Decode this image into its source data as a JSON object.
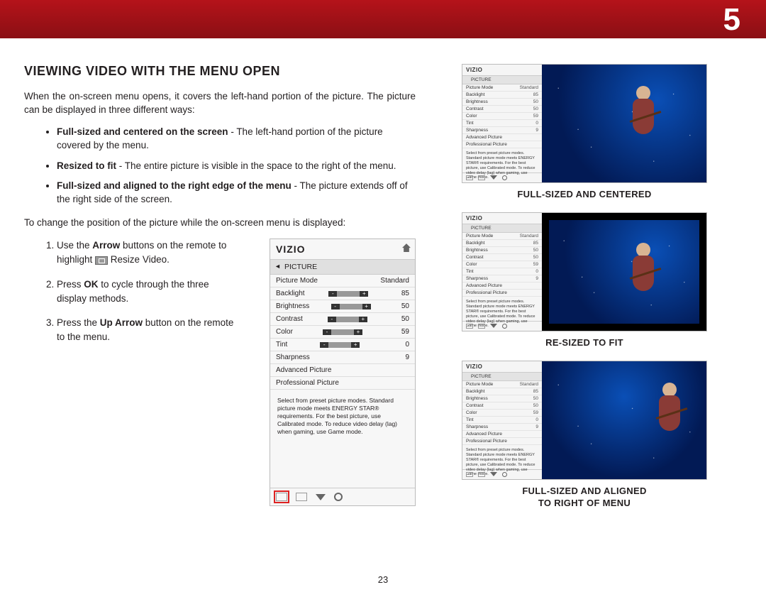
{
  "chapter_number": "5",
  "heading": "VIEWING VIDEO WITH THE MENU OPEN",
  "intro": "When the on-screen menu opens, it covers the left-hand portion of the picture. The picture can be displayed in three different ways:",
  "bullets": [
    {
      "bold": "Full-sized and centered on the screen",
      "rest": " - The left-hand portion of the picture covered by the menu."
    },
    {
      "bold": "Resized to fit",
      "rest": " - The entire picture is visible in the space to the right of the menu."
    },
    {
      "bold": "Full-sized and aligned to the right edge of the menu",
      "rest": " - The picture extends off of the right side of the screen."
    }
  ],
  "change_intro": "To change the position of the picture while the on-screen menu is displayed:",
  "steps": [
    {
      "pre": "Use the ",
      "b1": "Arrow",
      "mid": " buttons on the remote to highlight ",
      "b2": "",
      "post": " Resize Video.",
      "has_icon": true
    },
    {
      "pre": "Press ",
      "b1": "OK",
      "mid": " to cycle through the three display methods.",
      "b2": "",
      "post": "",
      "has_icon": false
    },
    {
      "pre": "Press the ",
      "b1": "Up Arrow",
      "mid": " button on the remote to the menu.",
      "b2": "",
      "post": "",
      "has_icon": false
    }
  ],
  "menu": {
    "brand": "VIZIO",
    "section": "PICTURE",
    "rows": [
      {
        "label": "Picture Mode",
        "type": "text",
        "value": "Standard"
      },
      {
        "label": "Backlight",
        "type": "slider",
        "value": "85"
      },
      {
        "label": "Brightness",
        "type": "slider",
        "value": "50"
      },
      {
        "label": "Contrast",
        "type": "slider",
        "value": "50"
      },
      {
        "label": "Color",
        "type": "slider",
        "value": "59"
      },
      {
        "label": "Tint",
        "type": "slider",
        "value": "0"
      },
      {
        "label": "Sharpness",
        "type": "slider",
        "value": "9"
      },
      {
        "label": "Advanced Picture",
        "type": "link",
        "value": ""
      },
      {
        "label": "Professional Picture",
        "type": "link",
        "value": ""
      }
    ],
    "footnote": "Select from preset picture modes. Standard picture mode meets ENERGY STAR® requirements. For the best picture, use Calibrated mode. To reduce video delay (lag) when gaming, use Game mode."
  },
  "captions": {
    "c1": "FULL-SIZED AND CENTERED",
    "c2": "RE-SIZED TO FIT",
    "c3a": "FULL-SIZED AND ALIGNED",
    "c3b": "TO RIGHT OF MENU"
  },
  "page_number": "23"
}
